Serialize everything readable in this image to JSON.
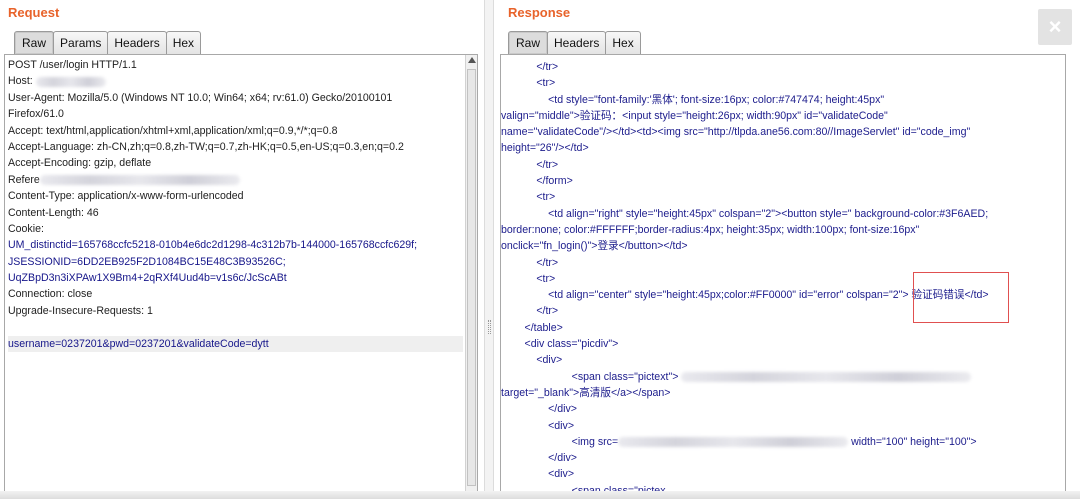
{
  "request": {
    "title": "Request",
    "tabs": [
      "Raw",
      "Params",
      "Headers",
      "Hex"
    ],
    "lines": [
      "POST /user/login HTTP/1.1",
      "Host:",
      "User-Agent: Mozilla/5.0 (Windows NT 10.0; Win64; x64; rv:61.0) Gecko/20100101",
      "Firefox/61.0",
      "Accept: text/html,application/xhtml+xml,application/xml;q=0.9,*/*;q=0.8",
      "Accept-Language: zh-CN,zh;q=0.8,zh-TW;q=0.7,zh-HK;q=0.5,en-US;q=0.3,en;q=0.2",
      "Accept-Encoding: gzip, deflate",
      "Refere",
      "Content-Type: application/x-www-form-urlencoded",
      "Content-Length: 46",
      "Cookie:"
    ],
    "cookie_lines": [
      "UM_distinctid=165768ccfc5218-010b4e6dc2d1298-4c312b7b-144000-165768ccfc629f;",
      "JSESSIONID=6DD2EB925F2D1084BC15E48C3B93526C;",
      "UqZBpD3n3iXPAw1X9Bm4+2qRXf4Uud4b=v1s6c/JcScABt"
    ],
    "tail_lines": [
      "Connection: close",
      "Upgrade-Insecure-Requests: 1"
    ],
    "body": "username=0237201&pwd=0237201&validateCode=dytt"
  },
  "response": {
    "title": "Response",
    "tabs": [
      "Raw",
      "Headers",
      "Hex"
    ],
    "lines": [
      "            </tr>",
      "            <tr>",
      "                <td style=\"font-family:'黑体'; font-size:16px; color:#747474; height:45px\"",
      "valign=\"middle\">验证码：<input style=\"height:26px; width:90px\" id=\"validateCode\"",
      "name=\"validateCode\"/></td><td><img src=\"http://tlpda.ane56.com:80//ImageServlet\" id=\"code_img\"",
      "height=\"26\"/></td>",
      "            </tr>",
      "            </form>",
      "            <tr>",
      "                <td align=\"right\" style=\"height:45px\" colspan=\"2\"><button style=\" background-color:#3F6AED;",
      "border:none; color:#FFFFFF;border-radius:4px; height:35px; width:100px; font-size:16px\"",
      "onclick=\"fn_login()\">登录</button></td>",
      "            </tr>",
      "            <tr>",
      "                <td align=\"center\" style=\"height:45px;color:#FF0000\" id=\"error\" colspan=\"2\"> 验证码错误</td>",
      "            </tr>",
      "        </table>",
      "        <div class=\"picdiv\">",
      "            <div>",
      "                        <span class=\"pictext\">",
      "target=\"_blank\">高清版</a></span>",
      "                </div>",
      "                <div>",
      "                        <img src=",
      "                </div>",
      "                <div>",
      "                        <span class=\"pictex"
    ],
    "img_tail": "width=\"100\" height=\"100\">"
  },
  "close_label": "×"
}
